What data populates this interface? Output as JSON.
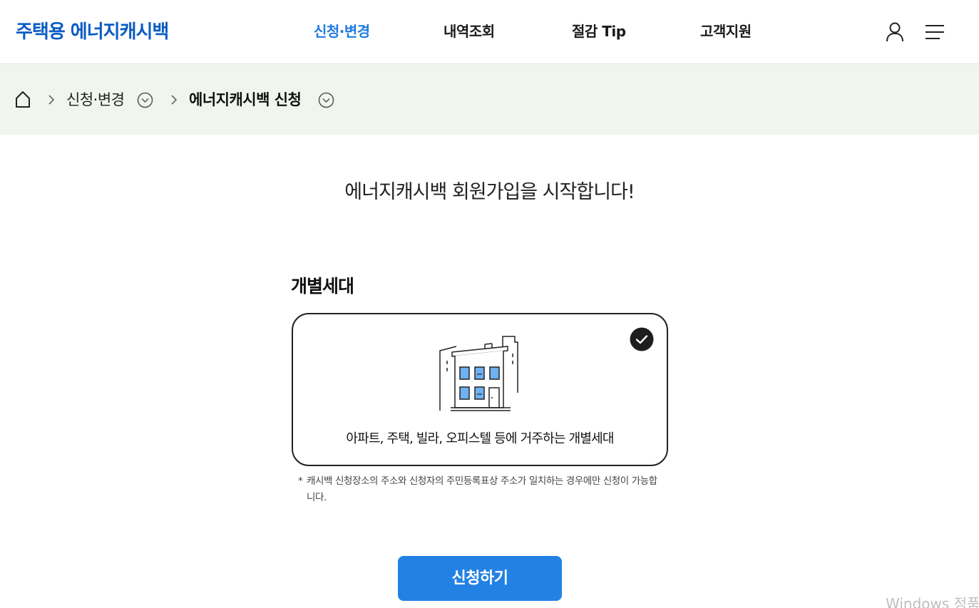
{
  "header": {
    "logo": "주택용 에너지캐시백",
    "nav": [
      {
        "label": "신청·변경",
        "active": true
      },
      {
        "label": "내역조회",
        "active": false
      },
      {
        "label": "절감 Tip",
        "active": false
      },
      {
        "label": "고객지원",
        "active": false
      }
    ],
    "icons": [
      "user-icon",
      "menu-icon"
    ]
  },
  "breadcrumb": {
    "icons": [
      "home-icon",
      "chevron-right-icon",
      "chevron-down-circle-icon"
    ],
    "items": [
      {
        "label": "신청·변경"
      },
      {
        "label": "에너지캐시백 신청"
      }
    ]
  },
  "main": {
    "title": "에너지캐시백 회원가입을 시작합니다!",
    "section_title": "개별세대",
    "option_card": {
      "description": "아파트, 주택, 빌라, 오피스텔 등에 거주하는 개별세대",
      "selected": true,
      "icons": [
        "building-icon",
        "check-icon"
      ]
    },
    "notice": {
      "marker": "*",
      "text": "캐시백 신청장소의 주소와 신청자의 주민등록표상 주소가 일치하는 경우에만 신청이 가능합니다."
    },
    "apply_button": "신청하기"
  },
  "overlay": {
    "watermark": "Windows 정품"
  },
  "colors": {
    "brand_blue": "#0b5cc4",
    "accent_blue": "#2381e3",
    "nav_active": "#1f7ae0",
    "breadcrumb_bg": "#f1f6ec",
    "window_fill": "#6fb1f2"
  }
}
